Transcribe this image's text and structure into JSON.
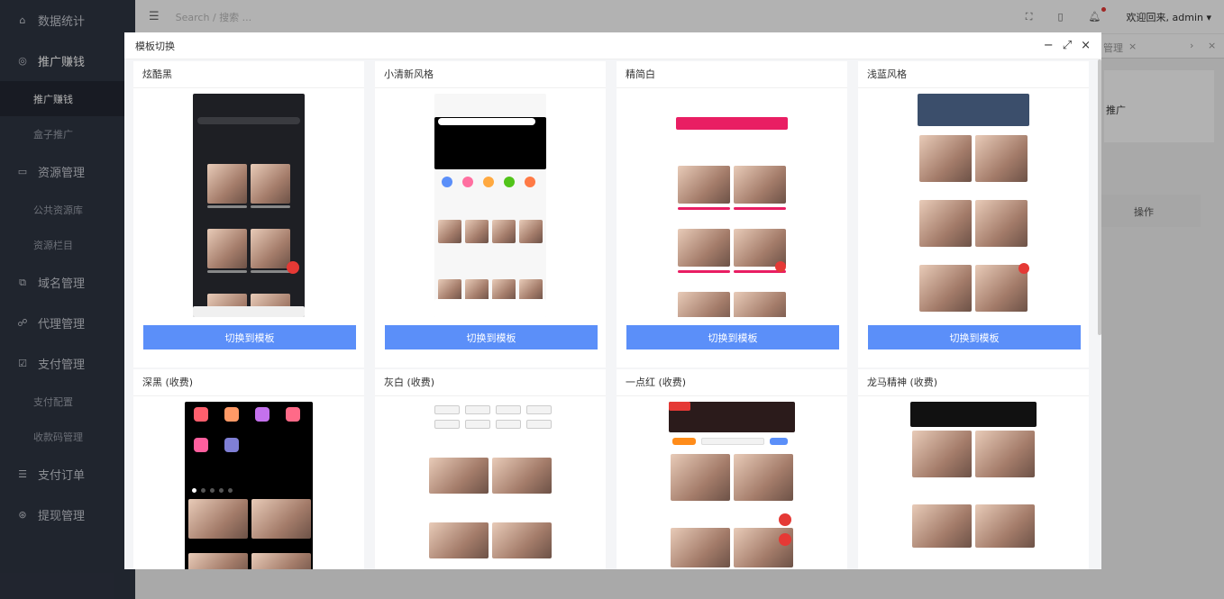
{
  "sidebar": {
    "items": [
      {
        "label": "数据统计",
        "icon": "home-icon",
        "glyph": "⌂"
      },
      {
        "label": "推广赚钱",
        "icon": "shield-icon",
        "glyph": "◎"
      },
      {
        "label": "推广赚钱",
        "sub": true,
        "active": true
      },
      {
        "label": "盒子推广",
        "sub": true
      },
      {
        "label": "资源管理",
        "icon": "resource-icon",
        "glyph": "▭"
      },
      {
        "label": "公共资源库",
        "sub": true
      },
      {
        "label": "资源栏目",
        "sub": true
      },
      {
        "label": "域名管理",
        "icon": "domain-icon",
        "glyph": "⧉"
      },
      {
        "label": "代理管理",
        "icon": "agent-icon",
        "glyph": "☍"
      },
      {
        "label": "支付管理",
        "icon": "pay-icon",
        "glyph": "☑"
      },
      {
        "label": "支付配置",
        "sub": true
      },
      {
        "label": "收款码管理",
        "sub": true
      },
      {
        "label": "支付订单",
        "icon": "order-icon",
        "glyph": "☰"
      },
      {
        "label": "提现管理",
        "icon": "withdraw-icon",
        "glyph": "⊛"
      }
    ]
  },
  "topbar": {
    "search_placeholder": "Search / 搜索 ...",
    "welcome": "欢迎回来, admin ▾"
  },
  "background": {
    "tab_fragment": "管理",
    "promo_fragment": "推广",
    "column_header": "操作"
  },
  "modal": {
    "title": "模板切换",
    "templates": [
      {
        "name": "炫酷黑",
        "button": "切换到模板",
        "theme": "dark"
      },
      {
        "name": "小清新风格",
        "button": "切换到模板",
        "theme": "fresh"
      },
      {
        "name": "精简白",
        "button": "切换到模板",
        "theme": "white"
      },
      {
        "name": "浅蓝风格",
        "button": "切换到模板",
        "theme": "blue"
      },
      {
        "name": "深黑 (收费)",
        "theme": "deepblack"
      },
      {
        "name": "灰白 (收费)",
        "theme": "grey"
      },
      {
        "name": "一点红 (收费)",
        "theme": "red"
      },
      {
        "name": "龙马精神 (收费)",
        "theme": "dragon"
      }
    ]
  },
  "colors": {
    "sidebar_bg": "#2f3543",
    "button_blue": "#5b8ff9",
    "accent_red": "#e53935"
  }
}
